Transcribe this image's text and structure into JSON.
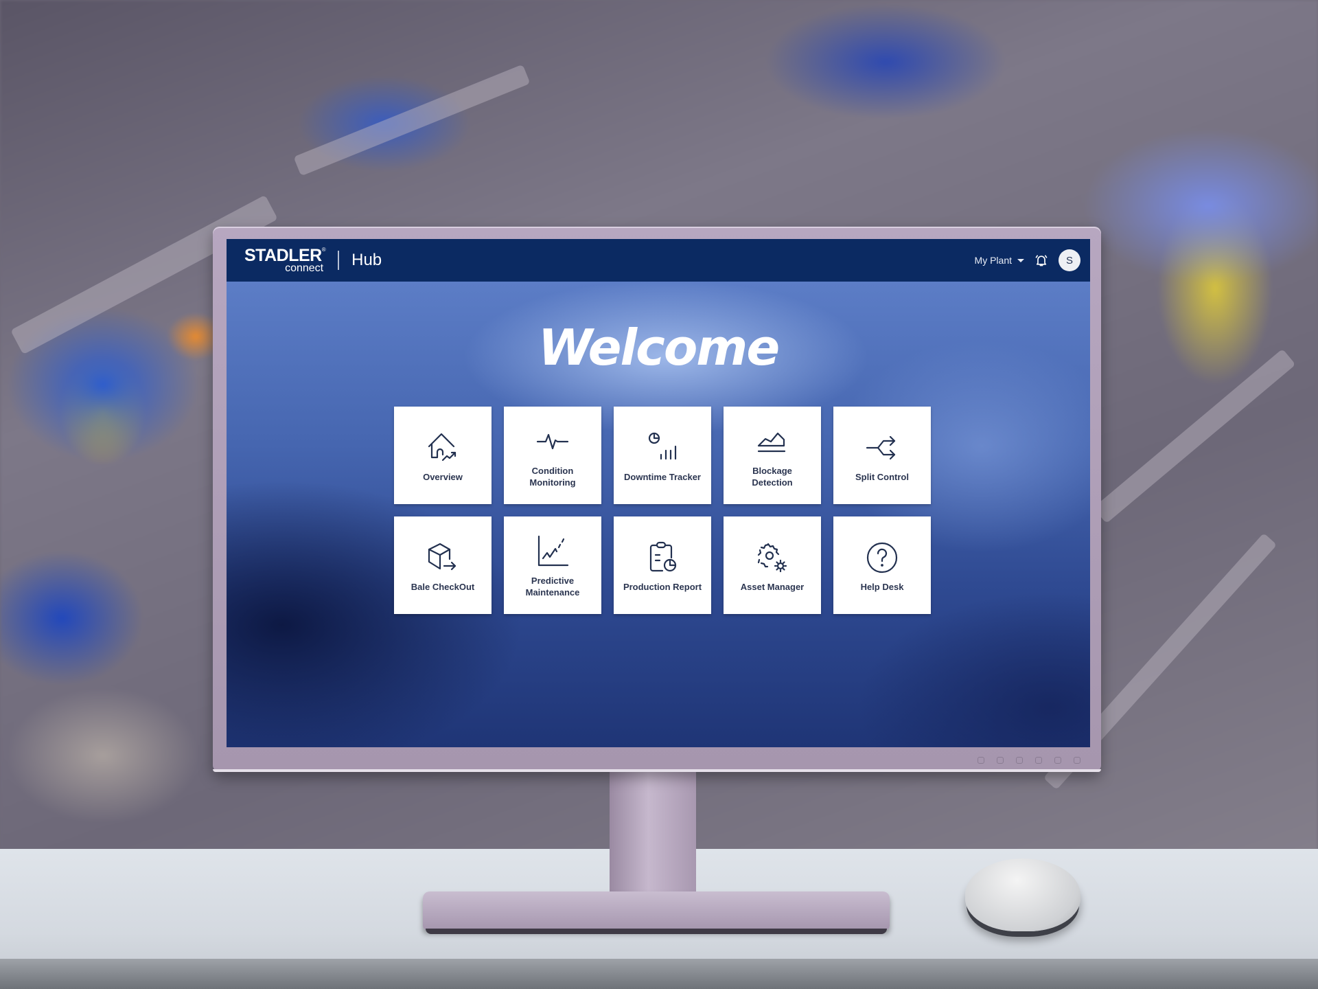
{
  "header": {
    "logo_main": "STADLER",
    "logo_registered": "®",
    "logo_sub": "connect",
    "app_title": "Hub",
    "plant_selector": "My Plant",
    "notification_icon": "bell-icon",
    "avatar_initial": "S"
  },
  "main": {
    "welcome": "Welcome",
    "tiles": [
      {
        "label": "Overview",
        "icon": "home-trend-icon"
      },
      {
        "label": "Condition\nMonitoring",
        "icon": "pulse-icon"
      },
      {
        "label": "Downtime Tracker",
        "icon": "clock-bars-icon"
      },
      {
        "label": "Blockage\nDetection",
        "icon": "area-chart-icon"
      },
      {
        "label": "Split Control",
        "icon": "split-arrows-icon"
      },
      {
        "label": "Bale CheckOut",
        "icon": "box-arrow-icon"
      },
      {
        "label": "Predictive\nMaintenance",
        "icon": "trend-chart-icon"
      },
      {
        "label": "Production Report",
        "icon": "clipboard-chart-icon"
      },
      {
        "label": "Asset Manager",
        "icon": "gears-icon"
      },
      {
        "label": "Help Desk",
        "icon": "help-circle-icon"
      }
    ]
  },
  "colors": {
    "topbar": "#0b2a62",
    "icon_stroke": "#22304f",
    "tile_background": "#ffffff"
  }
}
